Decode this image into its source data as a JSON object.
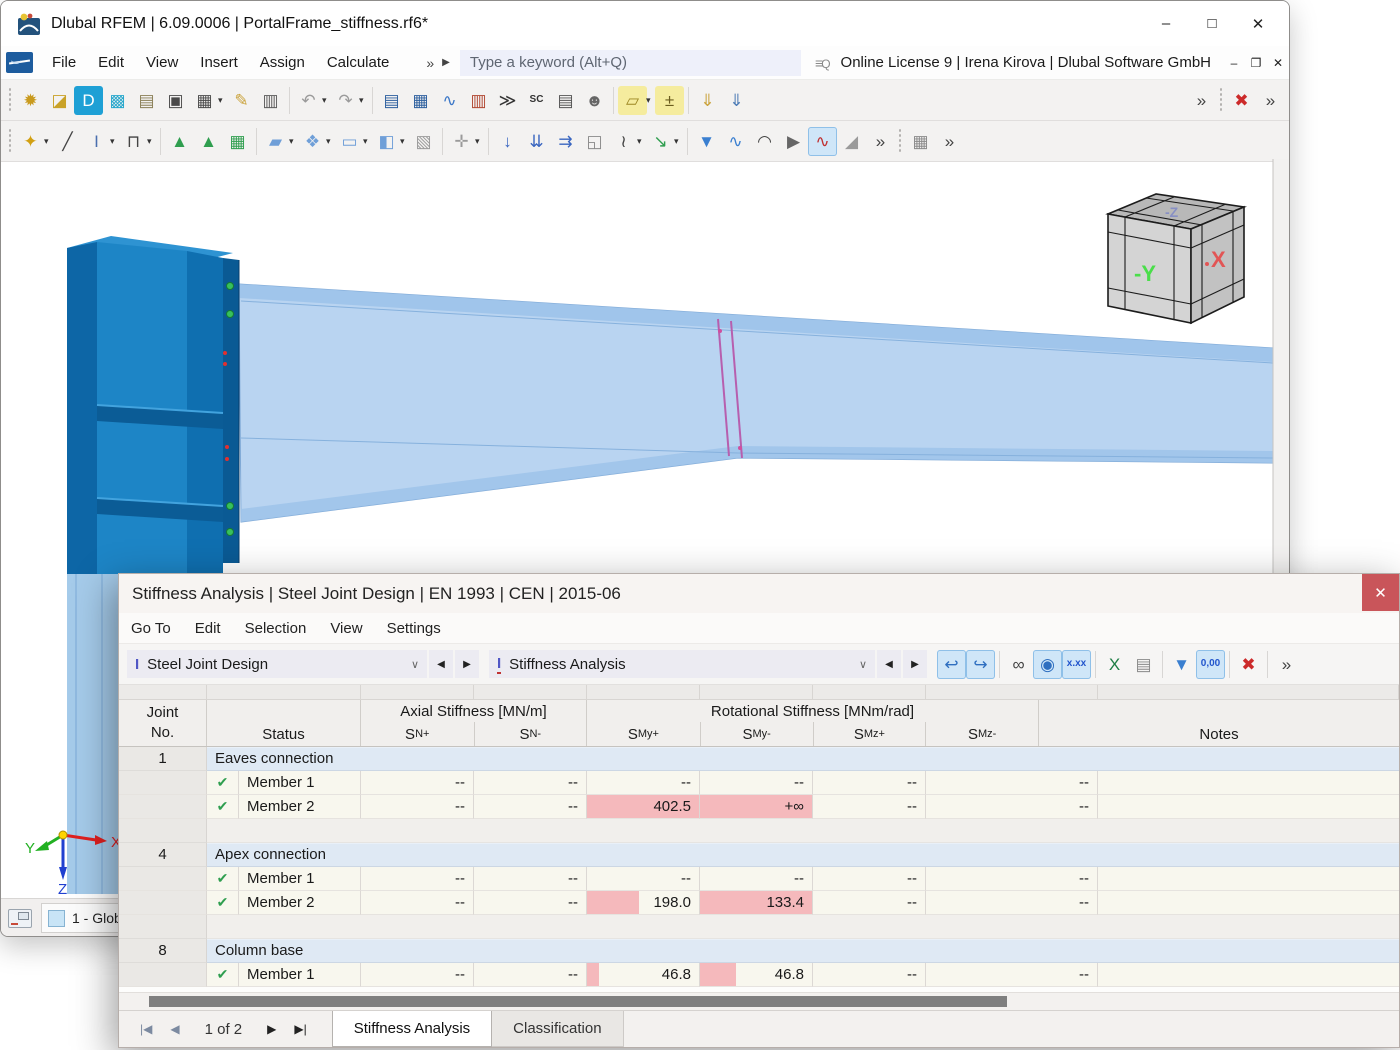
{
  "window": {
    "title": "Dlubal RFEM | 6.09.0006 | PortalFrame_stiffness.rf6*",
    "minimize": "–",
    "maximize": "□",
    "close": "✕"
  },
  "menubar": {
    "items": [
      "File",
      "Edit",
      "View",
      "Insert",
      "Assign",
      "Calculate"
    ],
    "overflow": "»",
    "expand": "▶",
    "search_placeholder": "Type a keyword (Alt+Q)",
    "search_icon": "≡",
    "license": "Online License 9 | Irena Kirova | Dlubal Software GmbH",
    "mini_minimize": "–",
    "mini_restore": "❐",
    "mini_close": "✕"
  },
  "toolbar1": [
    {
      "dots": true
    },
    {
      "n": "new-model-icon",
      "g": "✹",
      "c": "#c99a1d"
    },
    {
      "n": "open-model-icon",
      "g": "◪",
      "c": "#c9a227"
    },
    {
      "n": "dlubal-connect-icon",
      "g": "D",
      "c": "#ffffff",
      "bg": "#1ea0d5"
    },
    {
      "n": "import-model-icon",
      "g": "▩",
      "c": "#27a7cc"
    },
    {
      "n": "model-properties-icon",
      "g": "▤",
      "c": "#8a7f57"
    },
    {
      "n": "save-icon",
      "g": "▣",
      "c": "#4a4a4a"
    },
    {
      "n": "print-icon",
      "g": "▦",
      "c": "#4a4a4a",
      "dd": true
    },
    {
      "n": "new-printout-report-icon",
      "g": "✎",
      "c": "#caa23a"
    },
    {
      "n": "printout-report-icon",
      "g": "▥",
      "c": "#5a5a5a"
    },
    {
      "sep": true
    },
    {
      "n": "undo-icon",
      "g": "↶",
      "c": "#9b9b9b",
      "dd": true
    },
    {
      "n": "redo-icon",
      "g": "↷",
      "c": "#9b9b9b",
      "dd": true
    },
    {
      "sep": true
    },
    {
      "n": "navigator-panel-icon",
      "g": "▤",
      "c": "#2c5f9e"
    },
    {
      "n": "tables-panel-icon",
      "g": "▦",
      "c": "#2c5f9e"
    },
    {
      "n": "diagram-panel-icon",
      "g": "∿",
      "c": "#3c78c8"
    },
    {
      "n": "colored-tables-panel-icon",
      "g": "▥",
      "c": "#b0452f"
    },
    {
      "n": "console-panel-icon",
      "g": "≫",
      "c": "#333333"
    },
    {
      "n": "shortcut-panel-icon",
      "g": "SC",
      "c": "#333333",
      "small": true
    },
    {
      "n": "properties-panel-icon",
      "g": "▤",
      "c": "#555555"
    },
    {
      "n": "support-center-icon",
      "g": "☻",
      "c": "#666666"
    },
    {
      "sep": true
    },
    {
      "n": "new-visual-object-icon",
      "g": "▱",
      "c": "#9d8724",
      "bg": "#f5ec9e",
      "dd": true
    },
    {
      "n": "edit-parameters-icon",
      "g": "±",
      "c": "#6b5d1e",
      "bg": "#f5ec9e"
    },
    {
      "sep": true
    },
    {
      "n": "insert-object-icon",
      "g": "⇓",
      "c": "#caa23a"
    },
    {
      "n": "paste-object-icon",
      "g": "⇓",
      "c": "#4a7ab5"
    },
    {
      "gap": true
    },
    {
      "n": "toolbar1-overflow-icon",
      "g": "»",
      "c": "#444444"
    },
    {
      "dots": true
    },
    {
      "n": "cancel-zoom-icon",
      "g": "✖",
      "c": "#cc2a2a"
    },
    {
      "n": "toolbar1-overflow2-icon",
      "g": "»",
      "c": "#444444"
    }
  ],
  "toolbar2": [
    {
      "dots": true
    },
    {
      "n": "new-node-icon",
      "g": "✦",
      "c": "#d2a012",
      "dd": true
    },
    {
      "n": "new-line-icon",
      "g": "╱",
      "c": "#444444"
    },
    {
      "n": "new-member-icon",
      "g": "I",
      "c": "#4a6fae",
      "dd": true
    },
    {
      "n": "new-polyline-icon",
      "g": "⊓",
      "c": "#444444",
      "dd": true
    },
    {
      "sep": true
    },
    {
      "n": "new-nodal-support-icon",
      "g": "▲",
      "c": "#2f9e4f"
    },
    {
      "n": "new-line-support-icon",
      "g": "▲",
      "c": "#2f9e4f"
    },
    {
      "n": "new-surface-support-icon",
      "g": "▦",
      "c": "#2f9e4f"
    },
    {
      "sep": true
    },
    {
      "n": "new-surface-icon",
      "g": "▰",
      "c": "#6f9fd8",
      "dd": true
    },
    {
      "n": "new-solid-icon",
      "g": "❖",
      "c": "#6f9fd8",
      "dd": true
    },
    {
      "n": "new-opening-icon",
      "g": "▭",
      "c": "#6f9fd8",
      "dd": true
    },
    {
      "n": "new-block-icon",
      "g": "◧",
      "c": "#6f9fd8",
      "dd": true
    },
    {
      "n": "block-library-icon",
      "g": "▧",
      "c": "#9a9a9a"
    },
    {
      "sep": true
    },
    {
      "n": "new-rigid-link-icon",
      "g": "✛",
      "c": "#9a9a9a",
      "dd": true
    },
    {
      "sep": true
    },
    {
      "n": "new-nodal-load-icon",
      "g": "↓",
      "c": "#3a66c0"
    },
    {
      "n": "new-member-load-icon",
      "g": "⇊",
      "c": "#3a66c0"
    },
    {
      "n": "new-line-load-icon",
      "g": "⇉",
      "c": "#3a66c0"
    },
    {
      "n": "new-solid-load-icon",
      "g": "◱",
      "c": "#8a8a8a"
    },
    {
      "n": "new-imperfection-icon",
      "g": "≀",
      "c": "#444444",
      "dd": true
    },
    {
      "n": "new-imposed-displacement-icon",
      "g": "↘",
      "c": "#2f9e4f",
      "dd": true
    },
    {
      "sep": true
    },
    {
      "n": "results-filter-icon",
      "g": "▼",
      "c": "#3a7fd0"
    },
    {
      "n": "result-diagram-window-icon",
      "g": "∿",
      "c": "#3a7fd0"
    },
    {
      "n": "result-beam-icon",
      "g": "◠",
      "c": "#444444"
    },
    {
      "n": "animation-icon",
      "g": "▶",
      "c": "#666666"
    },
    {
      "n": "show-results-icon",
      "g": "∿",
      "c": "#c03030",
      "active": true
    },
    {
      "n": "surface-results-icon",
      "g": "◢",
      "c": "#9a9a9a"
    },
    {
      "n": "toolbar2-overflow-icon",
      "g": "»",
      "c": "#444444"
    },
    {
      "dots": true
    },
    {
      "n": "table-grid-icon",
      "g": "▦",
      "c": "#8a8a8a"
    },
    {
      "n": "toolbar2-overflow2-icon",
      "g": "»",
      "c": "#444444"
    }
  ],
  "viewport": {
    "cube": {
      "left": "-Y",
      "right": "X",
      "top": "-Z"
    },
    "axes": {
      "x": "X",
      "y": "Y",
      "z": "Z"
    },
    "view_tab": "1 - Glob"
  },
  "dialog": {
    "title": "Stiffness Analysis | Steel Joint Design | EN 1993 | CEN | 2015-06",
    "close_glyph": "✕",
    "menu": [
      "Go To",
      "Edit",
      "Selection",
      "View",
      "Settings"
    ],
    "toolbar": {
      "combo1": "Steel Joint Design",
      "combo2": "Stiffness Analysis",
      "combo_icon_glyph": "I",
      "chevron": "∨",
      "prev": "◀",
      "next": "▶",
      "icons": [
        {
          "n": "transfer-to-model-icon",
          "g": "↩",
          "c": "#2f6fc0",
          "active": true
        },
        {
          "n": "transfer-from-model-icon",
          "g": "↪",
          "c": "#2f6fc0",
          "active": true
        },
        {
          "sep": true
        },
        {
          "n": "view-mode-icon",
          "g": "∞",
          "c": "#444444"
        },
        {
          "n": "show-values-icon",
          "g": "◉",
          "c": "#2f6fc0",
          "active": true
        },
        {
          "n": "decimal-places-icon",
          "g": "x.xx",
          "c": "#2255cc",
          "active": true,
          "small": true
        },
        {
          "sep": true
        },
        {
          "n": "export-excel-icon",
          "g": "X",
          "c": "#1e7e45"
        },
        {
          "n": "print-report-icon",
          "g": "▤",
          "c": "#8a8a8a"
        },
        {
          "sep": true
        },
        {
          "n": "results-filter-icon",
          "g": "▼",
          "c": "#3a7fd0"
        },
        {
          "n": "units-settings-icon",
          "g": "0,00",
          "c": "#2255cc",
          "active": true,
          "small": true
        },
        {
          "sep": true
        },
        {
          "n": "delete-results-icon",
          "g": "✖",
          "c": "#cc2a2a"
        },
        {
          "sep": true
        },
        {
          "n": "dialog-toolbar-overflow-icon",
          "g": "»",
          "c": "#444444"
        }
      ]
    },
    "table": {
      "check_glyph": "✔",
      "header": {
        "joint": "Joint",
        "no": "No.",
        "status": "Status",
        "axial": "Axial Stiffness [MN/m]",
        "rotational": "Rotational Stiffness [MNm/rad]",
        "cols": [
          {
            "b": "S",
            "s": "N+"
          },
          {
            "b": "S",
            "s": "N-"
          },
          {
            "b": "S",
            "s": "My+"
          },
          {
            "b": "S",
            "s": "My-"
          },
          {
            "b": "S",
            "s": "Mz+"
          },
          {
            "b": "S",
            "s": "Mz-"
          }
        ],
        "notes": "Notes"
      },
      "rows": [
        {
          "type": "group",
          "no": "1",
          "title": "Eaves connection"
        },
        {
          "type": "member",
          "label": "Member 1",
          "values": [
            {
              "v": "--"
            },
            {
              "v": "--"
            },
            {
              "v": "--"
            },
            {
              "v": "--"
            },
            {
              "v": "--"
            },
            {
              "v": "--"
            }
          ],
          "notes": ""
        },
        {
          "type": "member",
          "label": "Member 2",
          "values": [
            {
              "v": "--"
            },
            {
              "v": "--"
            },
            {
              "v": "402.5",
              "bar": 1
            },
            {
              "v": "+∞",
              "bar": 1
            },
            {
              "v": "--"
            },
            {
              "v": "--"
            }
          ],
          "notes": ""
        },
        {
          "type": "spacer"
        },
        {
          "type": "group",
          "no": "4",
          "title": "Apex connection"
        },
        {
          "type": "member",
          "label": "Member 1",
          "values": [
            {
              "v": "--"
            },
            {
              "v": "--"
            },
            {
              "v": "--"
            },
            {
              "v": "--"
            },
            {
              "v": "--"
            },
            {
              "v": "--"
            }
          ],
          "notes": ""
        },
        {
          "type": "member",
          "label": "Member 2",
          "values": [
            {
              "v": "--"
            },
            {
              "v": "--"
            },
            {
              "v": "198.0",
              "bar": 0.46
            },
            {
              "v": "133.4",
              "bar": 1
            },
            {
              "v": "--"
            },
            {
              "v": "--"
            }
          ],
          "notes": ""
        },
        {
          "type": "spacer"
        },
        {
          "type": "group",
          "no": "8",
          "title": "Column base"
        },
        {
          "type": "member",
          "label": "Member 1",
          "values": [
            {
              "v": "--"
            },
            {
              "v": "--"
            },
            {
              "v": "46.8",
              "bar": 0.11
            },
            {
              "v": "46.8",
              "bar": 0.32
            },
            {
              "v": "--"
            },
            {
              "v": "--"
            }
          ],
          "notes": ""
        }
      ]
    },
    "pager": {
      "first": "|◀",
      "prev": "◀",
      "label": "1 of 2",
      "next": "▶",
      "last": "▶|"
    },
    "tabs": [
      {
        "label": "Stiffness Analysis",
        "active": true
      },
      {
        "label": "Classification",
        "active": false
      }
    ]
  },
  "colors": {
    "bar_pink": "#f5b9bc",
    "dialog_close_red": "#c9555a",
    "steel_blue": "#1d85c6",
    "rafter_blue": "#b9d4f1",
    "group_row_blue": "#dfe9f4",
    "member_row_cream": "#f8f7ee",
    "check_green": "#2f9e4f"
  }
}
